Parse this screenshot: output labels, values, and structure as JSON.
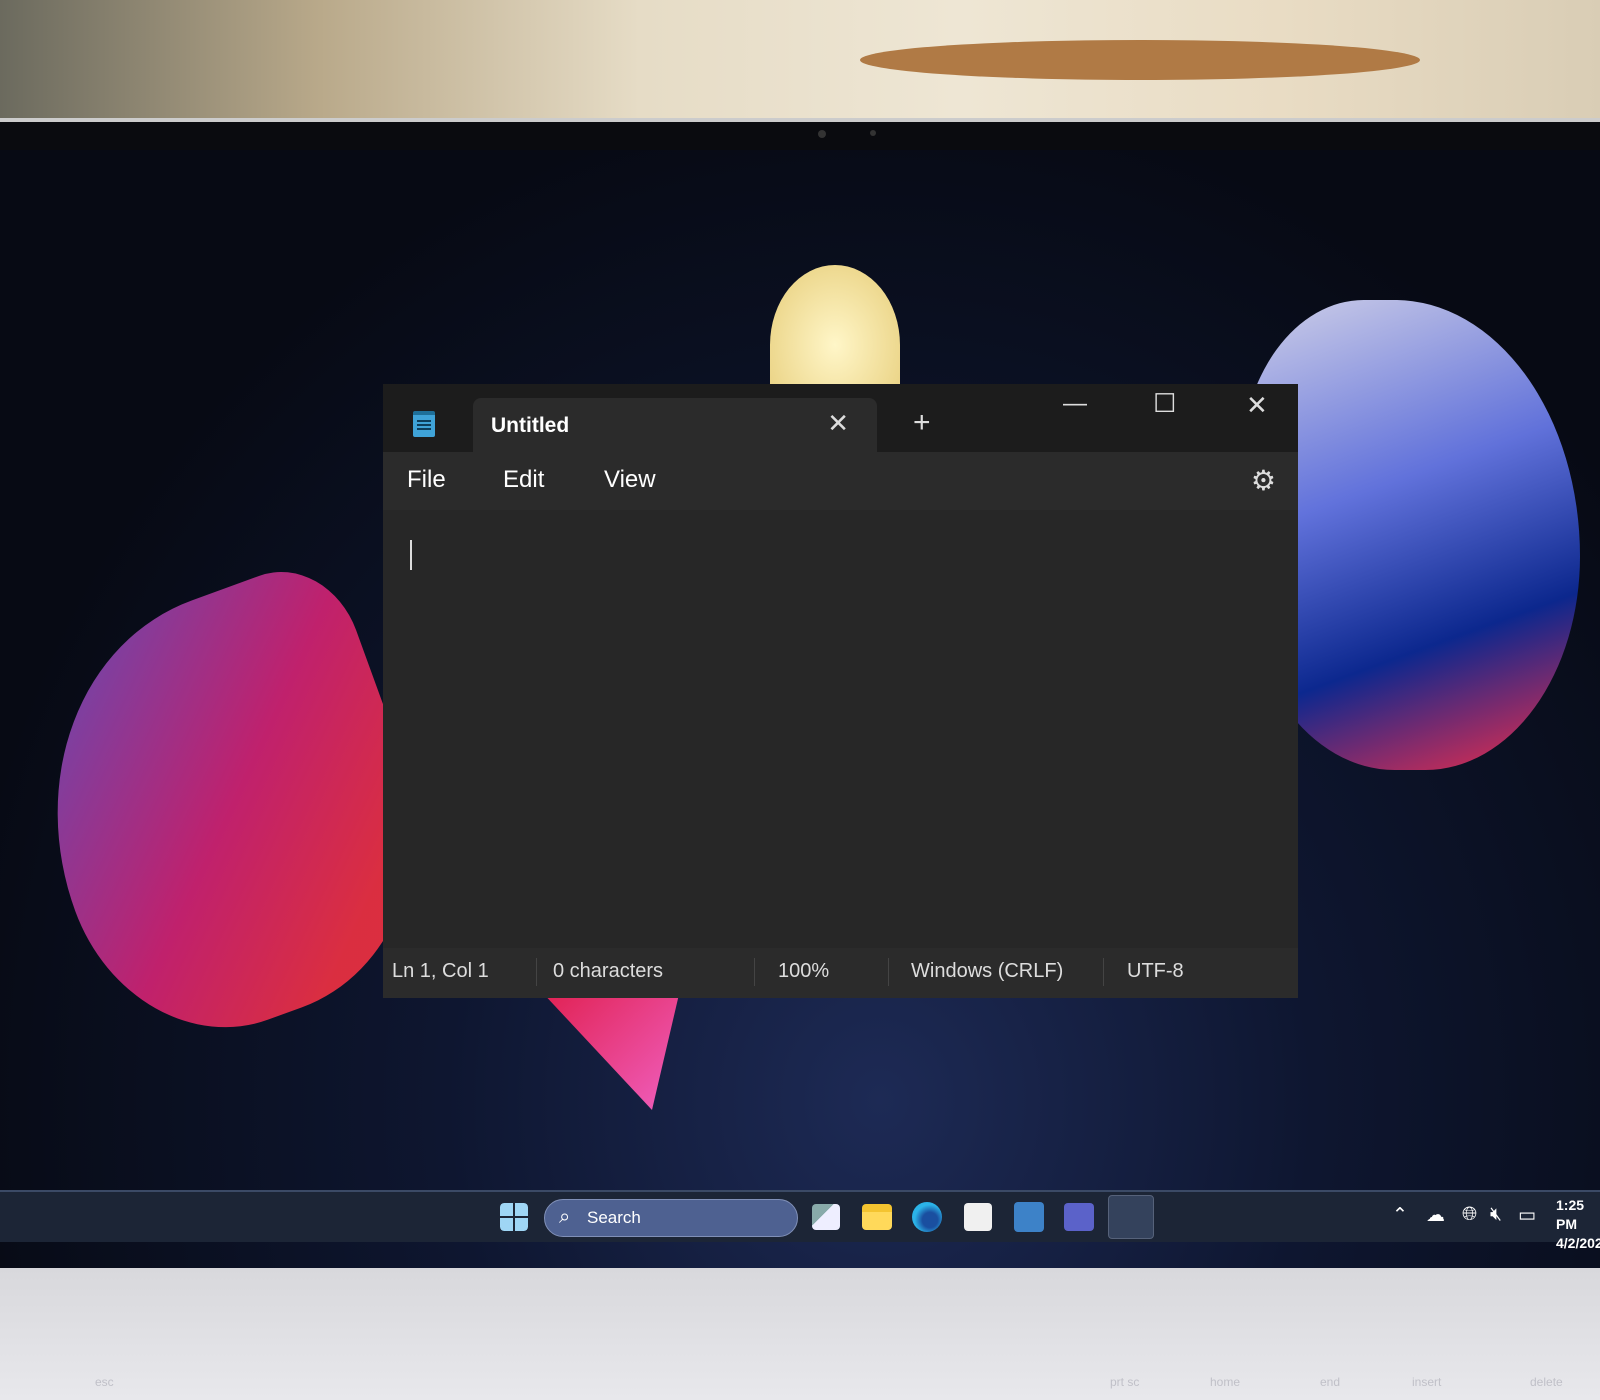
{
  "notepad": {
    "tab_title": "Untitled",
    "menu": [
      "File",
      "Edit",
      "View"
    ],
    "status": {
      "position": "Ln 1, Col 1",
      "characters": "0 characters",
      "zoom": "100%",
      "line_ending": "Windows (CRLF)",
      "encoding": "UTF-8"
    }
  },
  "taskbar": {
    "search_label": "Search",
    "clock_time": "1:25 PM",
    "clock_date": "4/2/202"
  },
  "keyboard": [
    "esc",
    "prt sc",
    "home",
    "end",
    "insert",
    "delete"
  ],
  "colors": {
    "accent": "#4e6191",
    "window_bg": "#202020",
    "taskbar_bg": "#1c2536"
  }
}
